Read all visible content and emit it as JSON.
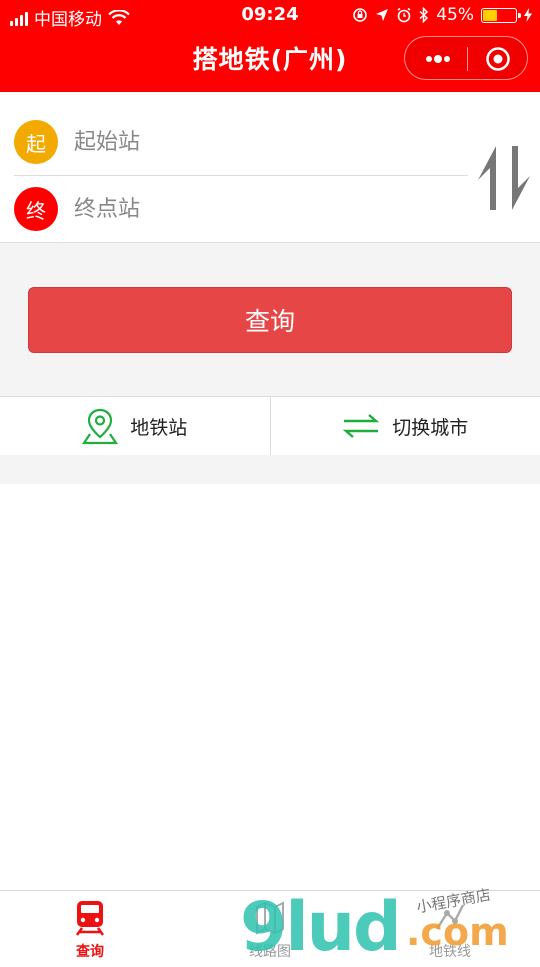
{
  "status_bar": {
    "carrier": "中国移动",
    "time": "09:24",
    "battery_percent": "45%",
    "battery_level": 0.45
  },
  "nav": {
    "title": "搭地铁(广州)",
    "more_icon": "more-dots-icon",
    "close_icon": "target-icon"
  },
  "route": {
    "start_badge": "起",
    "start_placeholder": "起始站",
    "end_badge": "终",
    "end_placeholder": "终点站",
    "swap_icon": "swap-vertical-icon"
  },
  "query_button": "查询",
  "actions": [
    {
      "label": "地铁站",
      "icon": "location-pin-icon"
    },
    {
      "label": "切换城市",
      "icon": "swap-horizontal-icon"
    }
  ],
  "tabbar": {
    "tabs": [
      {
        "label": "查询",
        "icon": "train-icon",
        "active": true
      },
      {
        "label": "线路图",
        "icon": "map-icon",
        "active": false
      },
      {
        "label": "地铁线",
        "icon": "line-icon",
        "active": false
      }
    ]
  },
  "watermark": {
    "brand": "9lud",
    "tld": ".com",
    "tagline": "小程序商店"
  },
  "colors": {
    "brand_red": "#fe0000",
    "button_red": "#e64646",
    "start_badge": "#f2a900",
    "end_badge": "#ff0000",
    "action_green": "#1fae3e"
  }
}
